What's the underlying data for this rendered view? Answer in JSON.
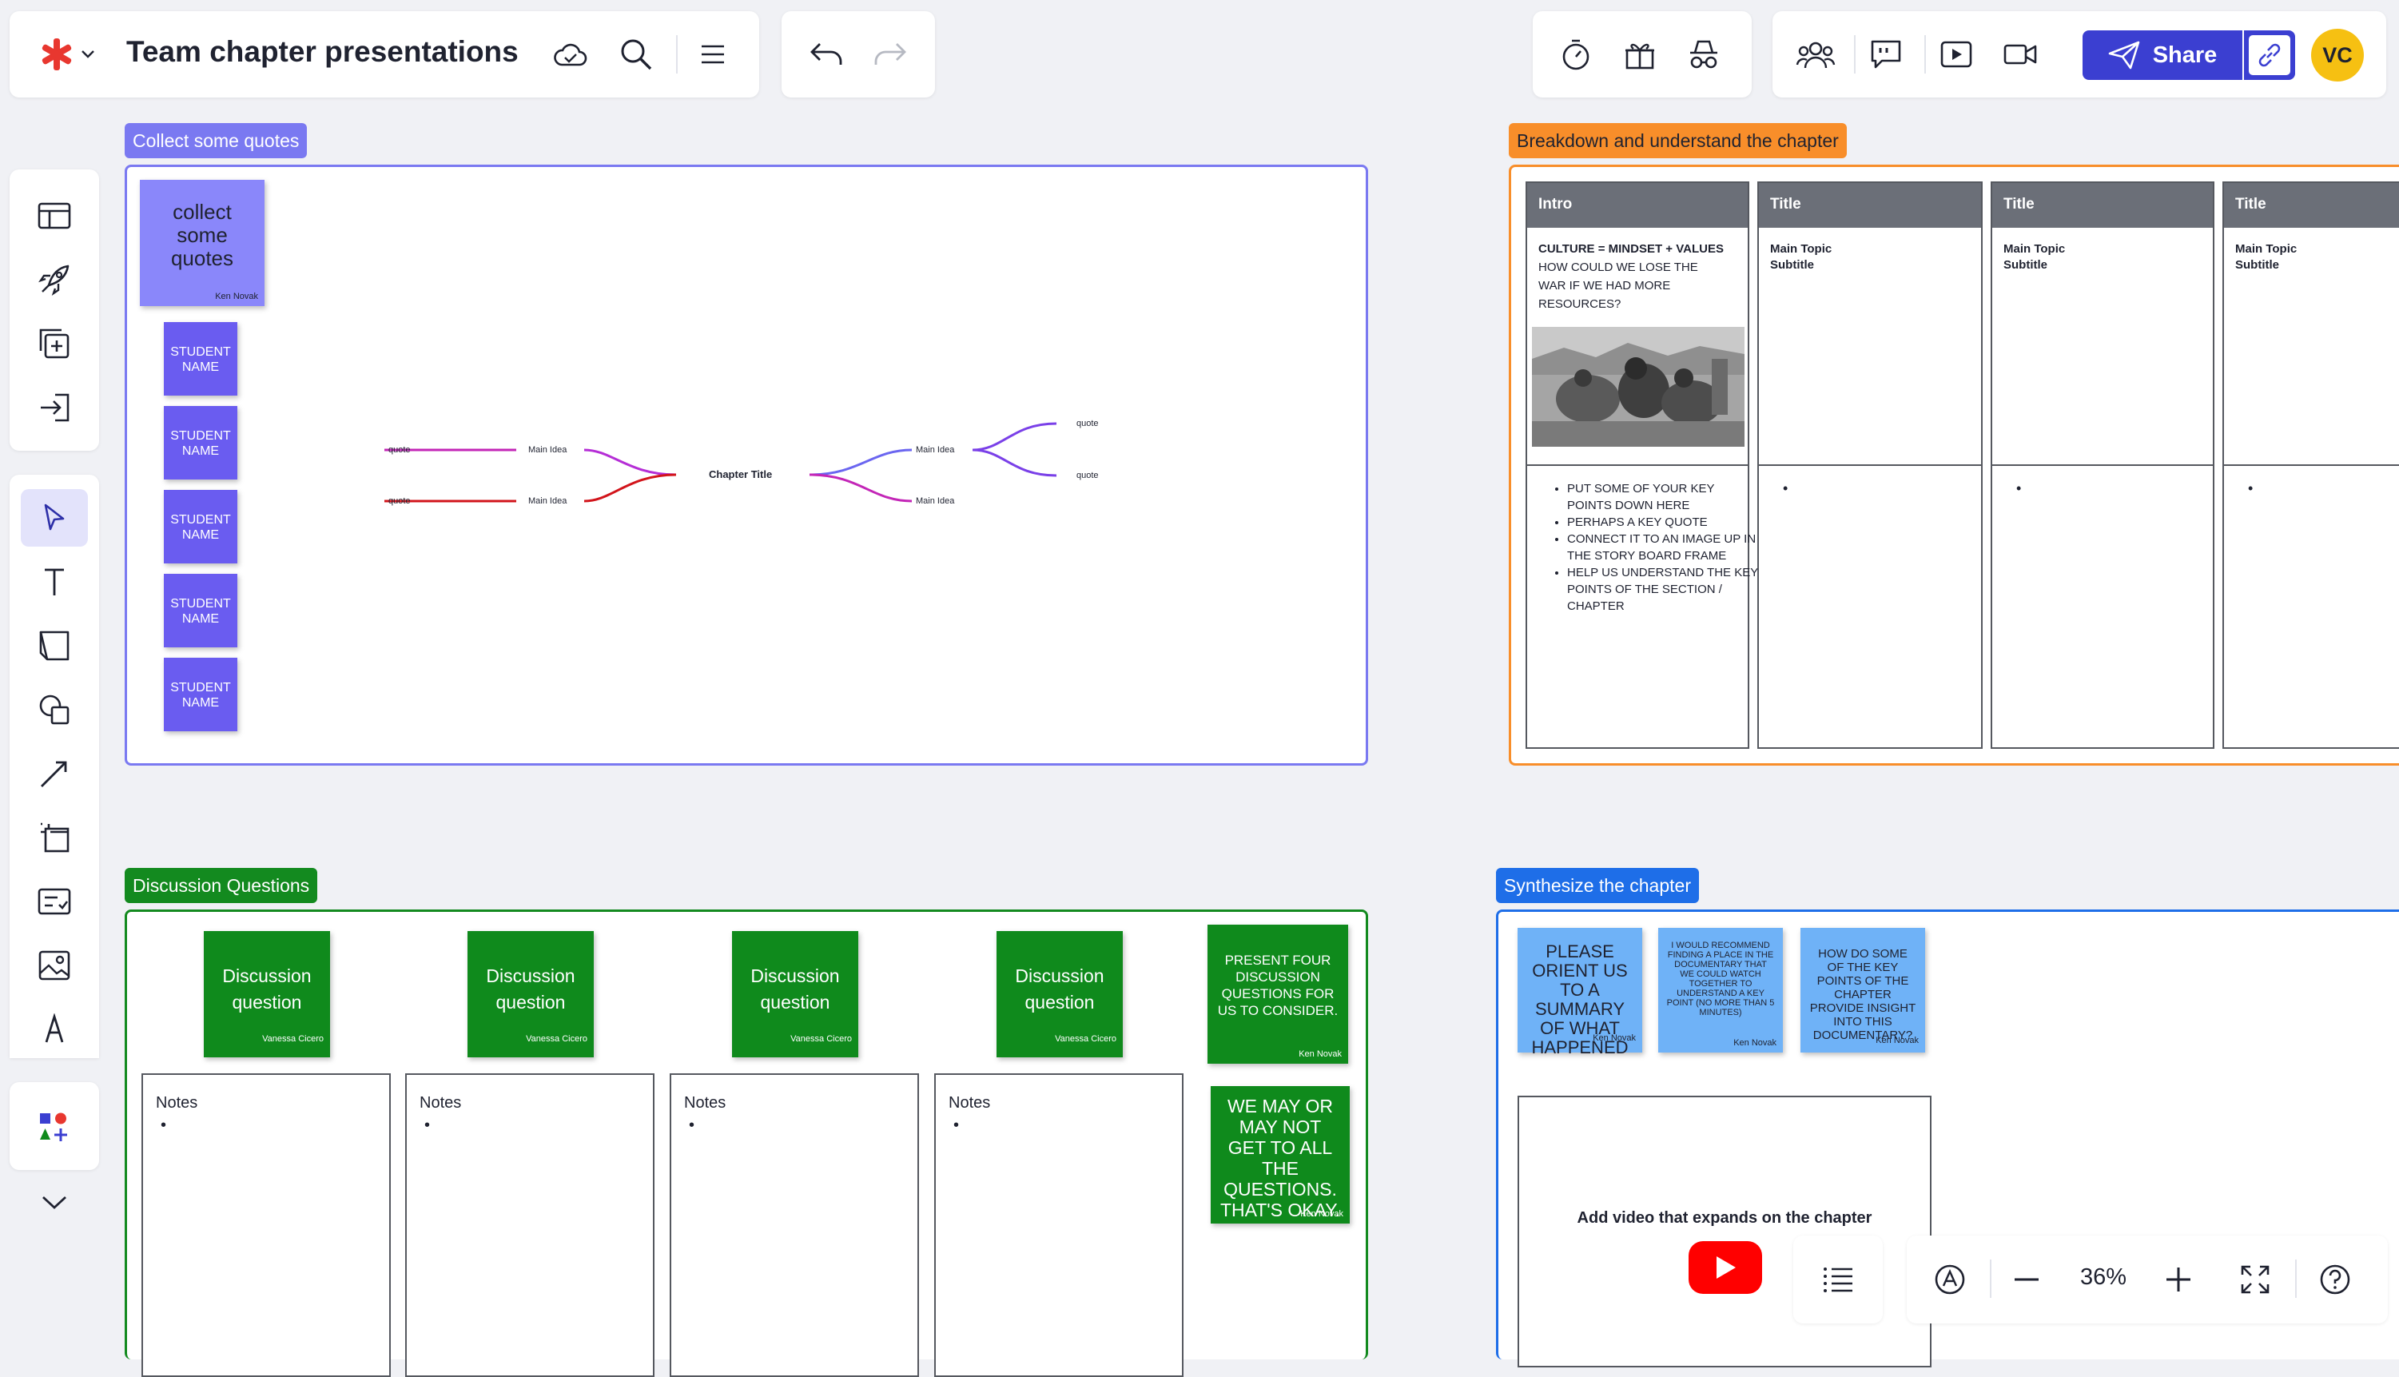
{
  "board": {
    "title": "Team chapter presentations"
  },
  "user": {
    "initials": "VC"
  },
  "share": {
    "label": "Share"
  },
  "zoom": {
    "level": "36%"
  },
  "frames": {
    "quotes": {
      "label": "Collect some quotes"
    },
    "breakdown": {
      "label": "Breakdown and understand the chapter"
    },
    "discussion": {
      "label": "Discussion Questions"
    },
    "synthesize": {
      "label": "Synthesize the chapter"
    }
  },
  "quotes": {
    "main_sticky": {
      "text": "collect some quotes",
      "author": "Ken Novak"
    },
    "student_stickies": [
      "STUDENT NAME",
      "STUDENT NAME",
      "STUDENT NAME",
      "STUDENT NAME",
      "STUDENT NAME"
    ],
    "mindmap": {
      "center": "Chapter Title",
      "left_ideas": [
        "Main Idea",
        "Main Idea"
      ],
      "left_quotes": [
        "quote",
        "quote"
      ],
      "right_ideas": [
        "Main Idea",
        "Main Idea"
      ],
      "right_quotes": [
        "quote",
        "quote"
      ]
    }
  },
  "breakdown": {
    "columns": [
      {
        "header": "Intro",
        "title_bold": "CULTURE = MINDSET + VALUES",
        "body": "HOW COULD WE LOSE THE WAR IF WE HAD MORE RESOURCES?",
        "bullets": [
          "PUT SOME OF YOUR KEY POINTS DOWN HERE",
          "PERHAPS A KEY QUOTE",
          "CONNECT IT TO AN IMAGE UP IN THE STORY BOARD FRAME",
          "HELP US UNDERSTAND THE KEY POINTS OF THE SECTION / CHAPTER"
        ]
      },
      {
        "header": "Title",
        "title_bold": "Main Topic",
        "subtitle": "Subtitle"
      },
      {
        "header": "Title",
        "title_bold": "Main Topic",
        "subtitle": "Subtitle"
      },
      {
        "header": "Title",
        "title_bold": "Main Topic",
        "subtitle": "Subtitle"
      }
    ]
  },
  "discussion": {
    "stickies": [
      {
        "text": "Discussion question",
        "author": "Vanessa Cicero"
      },
      {
        "text": "Discussion question",
        "author": "Vanessa Cicero"
      },
      {
        "text": "Discussion question",
        "author": "Vanessa Cicero"
      },
      {
        "text": "Discussion question",
        "author": "Vanessa Cicero"
      }
    ],
    "notes_label": "Notes",
    "side_stickies": [
      {
        "text": "PRESENT FOUR DISCUSSION QUESTIONS FOR US TO CONSIDER.",
        "author": "Ken Novak"
      },
      {
        "text": "WE MAY OR MAY NOT GET TO ALL THE QUESTIONS. THAT'S OKAY.",
        "author": "Ken Novak"
      }
    ]
  },
  "synthesize": {
    "stickies": [
      {
        "text": "PLEASE ORIENT US TO A SUMMARY OF WHAT HAPPENED",
        "author": "Ken Novak"
      },
      {
        "text": "I WOULD RECOMMEND FINDING A PLACE IN THE DOCUMENTARY THAT WE COULD WATCH TOGETHER TO UNDERSTAND A KEY POINT (NO MORE THAN 5 MINUTES)",
        "author": "Ken Novak"
      },
      {
        "text": "HOW DO SOME OF THE KEY POINTS OF THE CHAPTER PROVIDE INSIGHT INTO THIS DOCUMENTARY?",
        "author": "Ken Novak"
      }
    ],
    "video_label": "Add video that expands on the chapter"
  },
  "colors": {
    "purple_sticky": "#7e7bf7",
    "student_sticky": "#6a5cf0",
    "green_sticky": "#0f8a1c",
    "blue_sticky": "#6fb2f7",
    "share_button": "#3b3fd1",
    "avatar": "#f6c012",
    "logo": "#e8372f"
  },
  "icons": [
    "logo-icon",
    "chevron-down-icon",
    "cloud-icon",
    "search-icon",
    "menu-icon",
    "undo-icon",
    "redo-icon",
    "timer-icon",
    "gift-icon",
    "incognito-icon",
    "collaborators-icon",
    "comment-icon",
    "present-icon",
    "video-icon",
    "send-icon",
    "link-icon",
    "layout-icon",
    "rocket-icon",
    "add-frame-icon",
    "import-icon",
    "cursor-icon",
    "text-icon",
    "sticky-note-icon",
    "shapes-icon",
    "pen-icon",
    "frame-icon",
    "card-icon",
    "image-icon",
    "ink-icon",
    "apps-icon",
    "expand-icon",
    "list-icon",
    "ai-icon",
    "zoom-out-icon",
    "zoom-in-icon",
    "fit-icon",
    "help-icon",
    "youtube-icon"
  ]
}
